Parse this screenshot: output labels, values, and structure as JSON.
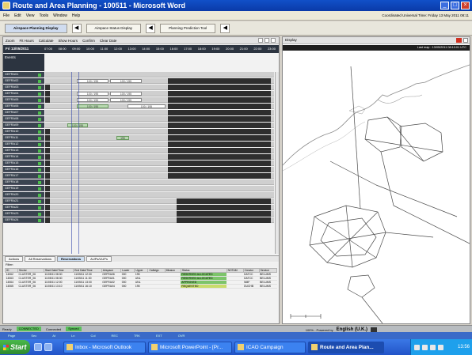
{
  "window": {
    "title": "Route and Area Planning - 100511 - Microsoft Word"
  },
  "menu": {
    "items": [
      "File",
      "Edit",
      "View",
      "Tools",
      "Window",
      "Help"
    ],
    "right_text": "Coordinated Universal Time: Friday 13 May 2011  08:11"
  },
  "toolbar": {
    "tabs": [
      "Airspace Planning Display",
      "Airspace Status Display",
      "Planning Prediction Tool"
    ]
  },
  "left": {
    "subtool": [
      "Zoom",
      "Fit Hours",
      "Calculate",
      "Show Hours",
      "Confirm",
      "Clear Date"
    ],
    "timeline_label": "Fri 13/05/2011",
    "ticks": [
      "07:00",
      "08:00",
      "09:00",
      "10:00",
      "11:00",
      "12:00",
      "13:00",
      "14:00",
      "15:00",
      "16:00",
      "17:00",
      "18:00",
      "19:00",
      "20:00",
      "21:00",
      "22:00",
      "23:00"
    ],
    "colhead": "Events",
    "rows": [
      {
        "label": "GEFRA01"
      },
      {
        "label": "GEFRA02"
      },
      {
        "label": "GEFRA03"
      },
      {
        "label": "GEFRA04"
      },
      {
        "label": "GEFRA05"
      },
      {
        "label": "GEFRA06"
      },
      {
        "label": "GEFRA07"
      },
      {
        "label": "GEFRA08"
      },
      {
        "label": "GEFRA09"
      },
      {
        "label": "GEFRA10"
      },
      {
        "label": "GEFRA11"
      },
      {
        "label": "GEFRA12"
      },
      {
        "label": "GEFRA13"
      },
      {
        "label": "GEFRA14"
      },
      {
        "label": "GEFRA15"
      },
      {
        "label": "GEFRA16"
      },
      {
        "label": "GEFRA17"
      },
      {
        "label": "GEFRA18"
      },
      {
        "label": "GEFRA19"
      },
      {
        "label": "GEFRA20"
      },
      {
        "label": "GEFRA21"
      },
      {
        "label": "GEFRA22"
      },
      {
        "label": "GEFRA23"
      },
      {
        "label": "GEFRA24"
      }
    ],
    "bars": {
      "b1": "100 / 195",
      "b2": "100 / 195",
      "b3": "100 / 195",
      "b4": "100 / 195",
      "b5": "100 / 195",
      "b6": "100 / 195",
      "b7": "100 / 195",
      "b8": "100 / 195",
      "b9": "100 / 195",
      "b10": "195"
    },
    "bottom_tabs": [
      "Actions",
      "All Reservations",
      "Reservations",
      "AUPs/UUPs"
    ],
    "filter": "Filter:",
    "table": {
      "headers": [
        "ID",
        "Sector",
        "Start Date/Time",
        "End Date/Time",
        "Airspace",
        "Lower",
        "Upper",
        "Callsign",
        "Mission",
        "Status",
        "NOTAM",
        "Creator",
        "Service"
      ],
      "rows": [
        [
          "14062",
          "CLUSTER_06",
          "11/05/11 08:30",
          "11/05/11 12:30",
          "GEFRA06",
          "000",
          "195",
          "",
          "",
          "RESERVED ALLOCATED",
          "",
          "DATCC",
          "BELUMS"
        ],
        [
          "14063",
          "CLUSTER_06",
          "11/05/11 08:30",
          "11/05/11 11:30",
          "GEFRA01",
          "000",
          "UNL",
          "",
          "",
          "RESERVED ALLOCATED",
          "",
          "DATCC",
          "BELUMS"
        ],
        [
          "14064",
          "CLUSTER_06",
          "11/05/11 12:00",
          "11/05/11 13:00",
          "GEFRA02",
          "000",
          "UNL",
          "",
          "",
          "APPROVED",
          "",
          "NMF",
          "BELUMS"
        ],
        [
          "14065",
          "CLUSTER_06",
          "11/05/11 13:10",
          "11/05/11 16:10",
          "GEFRA04",
          "000",
          "195",
          "",
          "",
          "REQUESTED",
          "",
          "DUCHB",
          "BELUMS"
        ]
      ]
    }
  },
  "right": {
    "title": "Display",
    "date": "Last map : 13/05/2011 08:10:01 UTC"
  },
  "status": {
    "left": "Ready",
    "chip1": "CONNECTED",
    "chip2": "Connected",
    "chip3": "Synced",
    "power": "100% - Powered by",
    "lang": "English (U.K.)"
  },
  "wordstatus": [
    "Page",
    "Sec",
    "At",
    "Ln",
    "Col",
    "REC",
    "TRK",
    "EXT",
    "OVR"
  ],
  "taskbar": {
    "start": "Start",
    "tasks": [
      "Inbox - Microsoft Outlook",
      "Microsoft PowerPoint - [Pr...",
      "ICAO Campaign",
      "Route and Area Plan..."
    ],
    "clock": "13:56"
  }
}
